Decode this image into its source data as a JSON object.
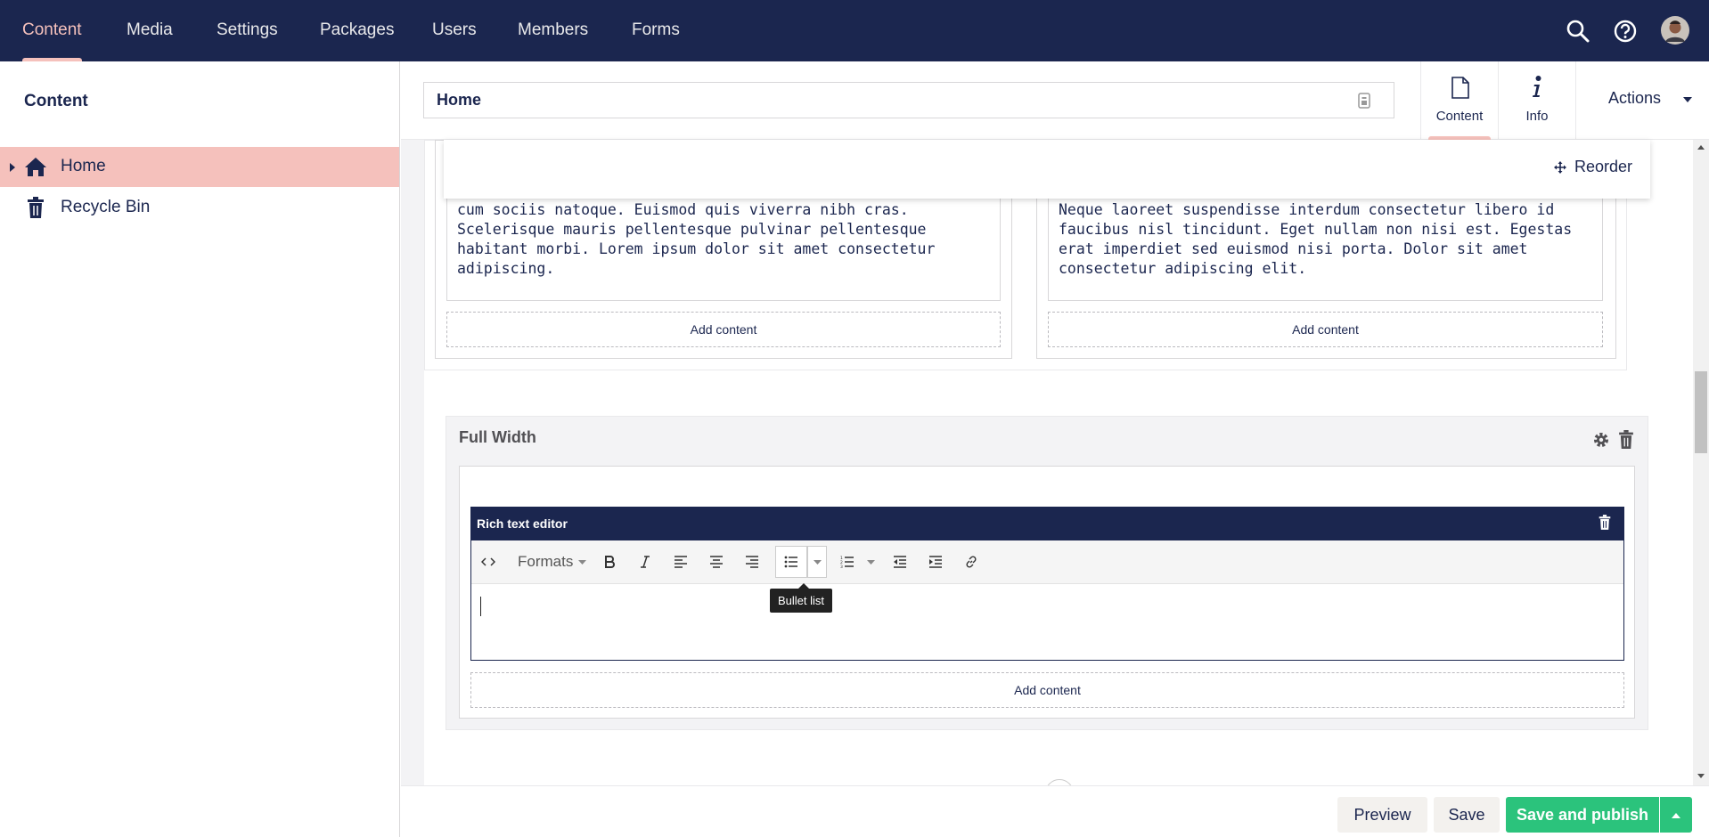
{
  "nav": {
    "items": [
      {
        "label": "Content",
        "active": true
      },
      {
        "label": "Media"
      },
      {
        "label": "Settings"
      },
      {
        "label": "Packages"
      },
      {
        "label": "Users"
      },
      {
        "label": "Members"
      },
      {
        "label": "Forms"
      }
    ],
    "icons": [
      "search-icon",
      "help-icon",
      "user-avatar"
    ]
  },
  "sidebar": {
    "title": "Content",
    "tree": [
      {
        "label": "Home",
        "icon": "home-icon",
        "selected": true
      },
      {
        "label": "Recycle Bin",
        "icon": "trash-icon"
      }
    ]
  },
  "header": {
    "name_value": "Home",
    "tabs": [
      {
        "label": "Content",
        "icon": "document-icon",
        "active": true
      },
      {
        "label": "Info",
        "icon": "info-icon"
      }
    ],
    "actions_label": "Actions"
  },
  "grid": {
    "reorder_label": "Reorder",
    "left_text": "cum sociis natoque. Euismod quis viverra nibh cras. Scelerisque mauris pellentesque pulvinar pellentesque habitant morbi. Lorem ipsum dolor sit amet consectetur adipiscing.",
    "right_text": "Neque laoreet suspendisse interdum consectetur libero id faucibus nisl tincidunt. Eget nullam non nisi est. Egestas erat imperdiet sed euismod nisi porta. Dolor sit amet consectetur adipiscing elit.",
    "add_content": "Add content",
    "full_width": {
      "title": "Full Width",
      "rte_title": "Rich text editor",
      "toolbar_formats": "Formats",
      "tooltip": "Bullet list"
    }
  },
  "footer": {
    "preview": "Preview",
    "save": "Save",
    "save_publish": "Save and publish"
  },
  "colors": {
    "brand_dark": "#1b264f",
    "accent_pink": "#f5c1bc",
    "publish_green": "#2bc37c"
  }
}
